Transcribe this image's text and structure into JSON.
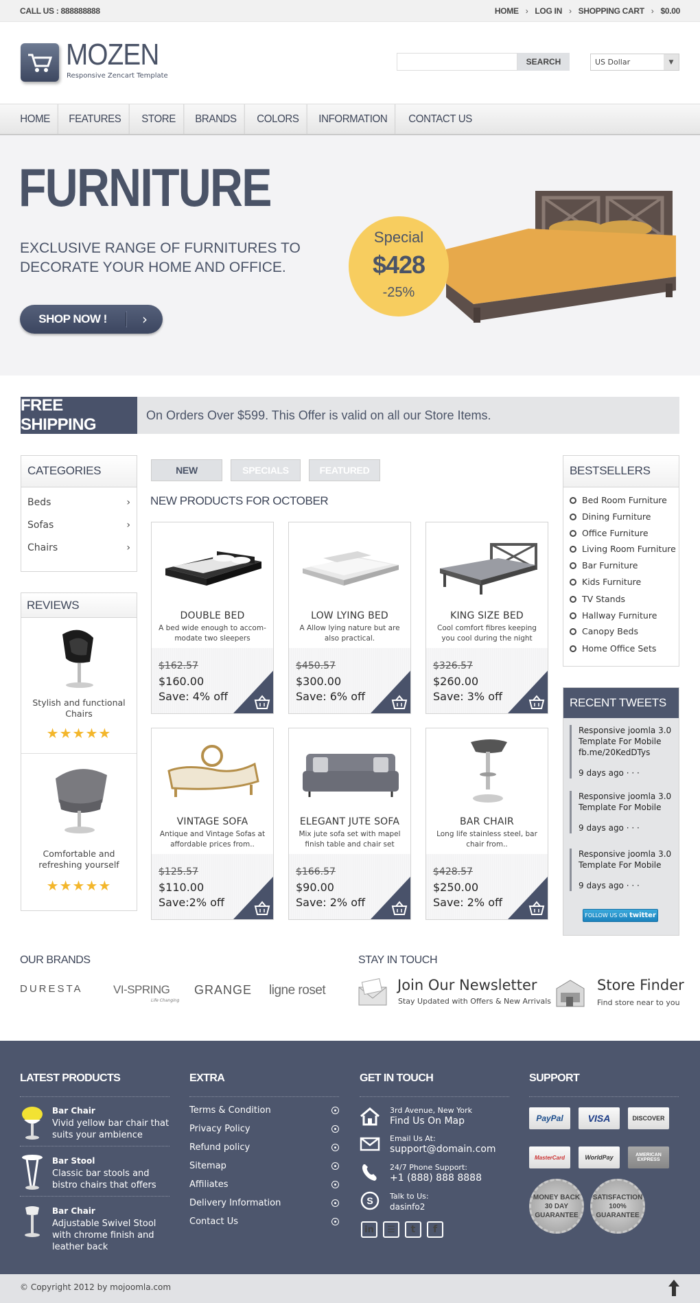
{
  "topbar": {
    "call": "CALL US : 888888888",
    "links": [
      "HOME",
      "LOG IN",
      "SHOPPING CART",
      "$0.00"
    ]
  },
  "header": {
    "logo_name": "MOZEN",
    "logo_tagline": "Responsive Zencart Template",
    "search_button": "SEARCH",
    "search_value": "",
    "currency": "US Dollar"
  },
  "nav": [
    "HOME",
    "FEATURES",
    "STORE",
    "BRANDS",
    "COLORS",
    "INFORMATION",
    "CONTACT US"
  ],
  "hero": {
    "title": "FURNITURE",
    "subtitle": "EXCLUSIVE RANGE OF FURNITURES TO DECORATE YOUR HOME AND OFFICE.",
    "button": "SHOP NOW !",
    "badge": {
      "line1": "Special",
      "price": "$428",
      "discount": "-25%"
    }
  },
  "shipping": {
    "label": "FREE SHIPPING",
    "text": "On Orders Over $599. This Offer is valid on all our Store Items."
  },
  "categories": {
    "title": "CATEGORIES",
    "items": [
      "Beds",
      "Sofas",
      "Chairs"
    ]
  },
  "reviews": {
    "title": "REVIEWS",
    "items": [
      {
        "name": "Stylish and functional Chairs",
        "stars": "★★★★★"
      },
      {
        "name": "Comfortable and refreshing yourself",
        "stars": "★★★★★"
      }
    ]
  },
  "tabs": [
    "NEW",
    "SPECIALS",
    "FEATURED"
  ],
  "new_products_title": "NEW PRODUCTS FOR OCTOBER",
  "products": [
    {
      "name": "DOUBLE BED",
      "desc": "A bed wide enough to accom-modate two sleepers",
      "old": "$162.57",
      "price": "$160.00",
      "save": "Save: 4% off"
    },
    {
      "name": "LOW LYING BED",
      "desc": "A  Allow lying nature but are also practical.",
      "old": "$450.57",
      "price": "$300.00",
      "save": "Save: 6% off"
    },
    {
      "name": "KING SIZE BED",
      "desc": "Cool comfort fibres keeping you cool during the night",
      "old": "$326.57",
      "price": "$260.00",
      "save": "Save: 3% off"
    },
    {
      "name": "VINTAGE SOFA",
      "desc": "Antique and Vintage Sofas at affordable prices from..",
      "old": "$125.57",
      "price": "$110.00",
      "save": "Save:2% off"
    },
    {
      "name": "ELEGANT JUTE SOFA",
      "desc": "Mix jute sofa set with mapel finish table and chair set",
      "old": "$166.57",
      "price": "$90.00",
      "save": "Save: 2% off"
    },
    {
      "name": "BAR CHAIR",
      "desc": "Long life stainless steel, bar chair from..",
      "old": "$428.57",
      "price": "$250.00",
      "save": "Save: 2% off"
    }
  ],
  "bestsellers": {
    "title": "BESTSELLERS",
    "items": [
      "Bed Room Furniture",
      "Dining Furniture",
      "Office Furniture",
      "Living Room Furniture",
      "Bar Furniture",
      "Kids Furniture",
      "TV Stands",
      "Hallway Furniture",
      "Canopy Beds",
      "Home Office Sets"
    ]
  },
  "tweets": {
    "title": "RECENT TWEETS",
    "items": [
      {
        "text": "Responsive joomla 3.0 Template For Mobile fb.me/20KedDTys",
        "ago": "9 days ago · · ·"
      },
      {
        "text": "Responsive joomla 3.0 Template For Mobile",
        "ago": "9 days ago · · ·"
      },
      {
        "text": "Responsive joomla 3.0 Template For Mobile",
        "ago": "9 days ago · · ·"
      }
    ],
    "follow_prefix": "FOLLOW US ON",
    "follow_brand": "twitter"
  },
  "brands": {
    "title": "OUR BRANDS",
    "items": [
      "DURESTA",
      "VI-SPRING",
      "GRANGE",
      "ligne roset"
    ],
    "vispring_tag": "Life Changing"
  },
  "stay": {
    "title": "STAY IN TOUCH",
    "newsletter_title": "Join Our Newsletter",
    "newsletter_sub": "Stay Updated with Offers & New Arrivals",
    "finder_title": "Store Finder",
    "finder_sub": "Find store near to you"
  },
  "footer": {
    "latest": {
      "title": "LATEST PRODUCTS",
      "items": [
        {
          "name": "Bar Chair",
          "desc": "Vivid yellow bar chair that suits your ambience"
        },
        {
          "name": "Bar Stool",
          "desc": "Classic bar stools and bistro chairs that offers"
        },
        {
          "name": "Bar Chair",
          "desc": "Adjustable Swivel Stool with chrome finish and leather back"
        }
      ]
    },
    "extra": {
      "title": "EXTRA",
      "items": [
        "Terms & Condition",
        "Privacy Policy",
        "Refund policy",
        "Sitemap",
        "Affiliates",
        "Delivery Information",
        "Contact Us"
      ]
    },
    "touch": {
      "title": "GET IN TOUCH",
      "items": [
        {
          "label": "3rd Avenue, New York",
          "value": "Find Us On Map"
        },
        {
          "label": "Email Us At:",
          "value": "support@domain.com"
        },
        {
          "label": "24/7 Phone Support:",
          "value": "+1 (888) 888 8888"
        },
        {
          "label": "Talk to Us:",
          "value": "dasinfo2"
        }
      ]
    },
    "support": {
      "title": "SUPPORT",
      "cards": [
        "PayPal",
        "VISA",
        "DISCOVER",
        "MasterCard",
        "WorldPay",
        "AMERICAN EXPRESS"
      ],
      "seal1": "MONEY BACK 30 DAY GUARANTEE",
      "seal2": "SATISFACTION 100% GUARANTEE"
    }
  },
  "copyright": "© Copyright 2012 by mojoomla.com"
}
